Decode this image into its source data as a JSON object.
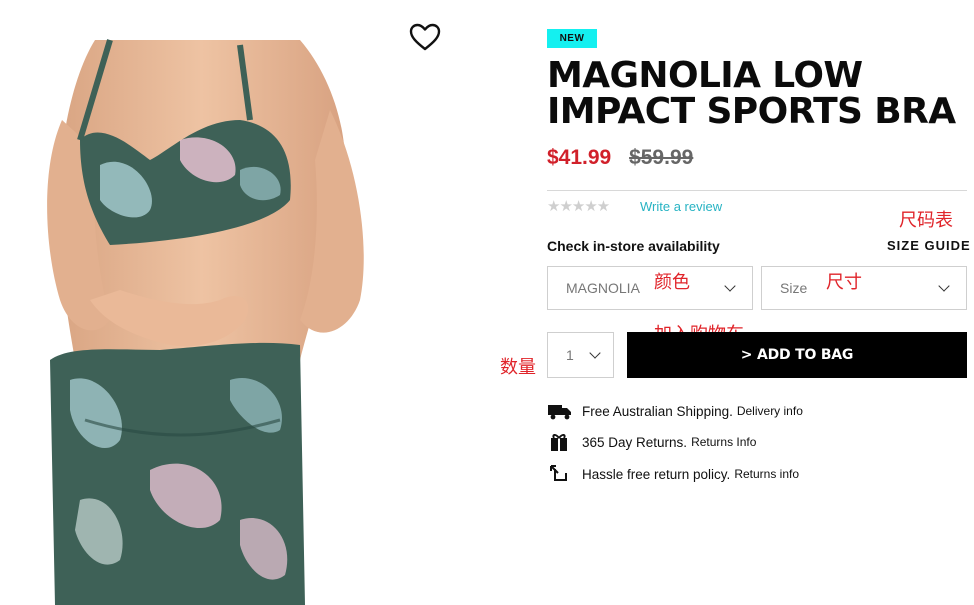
{
  "product": {
    "badge": "NEW",
    "title": "MAGNOLIA LOW IMPACT SPORTS BRA",
    "sale_price": "$41.99",
    "original_price": "$59.99",
    "rating_stars": "★★★★★",
    "write_review": "Write a review"
  },
  "availability": {
    "check_in_store": "Check in-store availability",
    "size_guide": "SIZE GUIDE"
  },
  "selectors": {
    "color_value": "MAGNOLIA",
    "size_placeholder": "Size",
    "quantity_value": "1"
  },
  "cart": {
    "add_to_bag": "> ADD TO BAG"
  },
  "perks": [
    {
      "main": "Free Australian Shipping.",
      "link": "Delivery info",
      "icon": "truck-icon"
    },
    {
      "main": "365 Day Returns.",
      "link": "Returns Info",
      "icon": "gift-box-icon"
    },
    {
      "main": "Hassle free return policy.",
      "link": "Returns info",
      "icon": "return-arrow-icon"
    }
  ],
  "annotations": {
    "size_chart": "尺码表",
    "color": "颜色",
    "size": "尺寸",
    "add_to_cart": "加入购物车",
    "quantity": "数量"
  },
  "colors": {
    "badge": "#14f0f0",
    "sale": "#d1202a",
    "review_link": "#27b3c3",
    "button": "#000000",
    "annotation": "#e0242a",
    "print_base": "#3e6157"
  }
}
